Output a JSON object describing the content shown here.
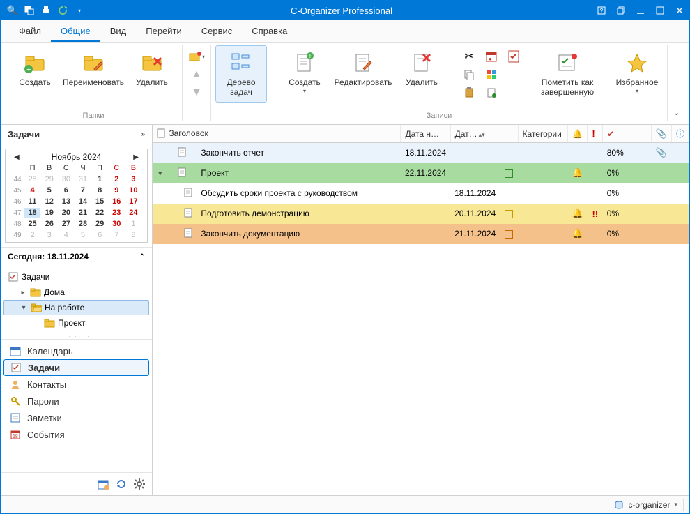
{
  "title": "C-Organizer Professional",
  "menu": [
    "Файл",
    "Общие",
    "Вид",
    "Перейти",
    "Сервис",
    "Справка"
  ],
  "menu_active": 1,
  "ribbon": {
    "groups": [
      {
        "label": "Папки",
        "buttons": [
          "Создать",
          "Переименовать",
          "Удалить"
        ]
      },
      {
        "label": "Записи",
        "tree_btn": "Дерево задач",
        "buttons": [
          "Создать",
          "Редактировать",
          "Удалить"
        ],
        "mark_btn": "Пометить как завершенную",
        "fav_btn": "Избранное"
      }
    ]
  },
  "sidebar": {
    "header": "Задачи",
    "calendar": {
      "month": "Ноябрь 2024",
      "dow": [
        "П",
        "В",
        "С",
        "Ч",
        "П",
        "С",
        "В"
      ],
      "weeks": [
        {
          "wk": "44",
          "days": [
            {
              "d": "28",
              "dim": true
            },
            {
              "d": "29",
              "dim": true
            },
            {
              "d": "30",
              "dim": true
            },
            {
              "d": "31",
              "dim": true
            },
            {
              "d": "1",
              "bold": true
            },
            {
              "d": "2",
              "bold": true,
              "red": true
            },
            {
              "d": "3",
              "bold": true,
              "red": true
            }
          ]
        },
        {
          "wk": "45",
          "days": [
            {
              "d": "4",
              "bold": true,
              "red": true
            },
            {
              "d": "5",
              "bold": true
            },
            {
              "d": "6",
              "bold": true
            },
            {
              "d": "7",
              "bold": true
            },
            {
              "d": "8",
              "bold": true
            },
            {
              "d": "9",
              "bold": true,
              "red": true
            },
            {
              "d": "10",
              "bold": true,
              "red": true
            }
          ]
        },
        {
          "wk": "46",
          "days": [
            {
              "d": "11",
              "bold": true
            },
            {
              "d": "12",
              "bold": true
            },
            {
              "d": "13",
              "bold": true
            },
            {
              "d": "14",
              "bold": true
            },
            {
              "d": "15",
              "bold": true
            },
            {
              "d": "16",
              "bold": true,
              "red": true
            },
            {
              "d": "17",
              "bold": true,
              "red": true
            }
          ]
        },
        {
          "wk": "47",
          "days": [
            {
              "d": "18",
              "bold": true,
              "today": true
            },
            {
              "d": "19",
              "bold": true
            },
            {
              "d": "20",
              "bold": true
            },
            {
              "d": "21",
              "bold": true
            },
            {
              "d": "22",
              "bold": true
            },
            {
              "d": "23",
              "bold": true,
              "red": true
            },
            {
              "d": "24",
              "bold": true,
              "red": true
            }
          ]
        },
        {
          "wk": "48",
          "days": [
            {
              "d": "25",
              "bold": true
            },
            {
              "d": "26",
              "bold": true
            },
            {
              "d": "27",
              "bold": true
            },
            {
              "d": "28",
              "bold": true
            },
            {
              "d": "29",
              "bold": true
            },
            {
              "d": "30",
              "bold": true,
              "red": true
            },
            {
              "d": "1",
              "dim": true,
              "red": true
            }
          ]
        },
        {
          "wk": "49",
          "days": [
            {
              "d": "2",
              "dim": true
            },
            {
              "d": "3",
              "dim": true
            },
            {
              "d": "4",
              "dim": true
            },
            {
              "d": "5",
              "dim": true
            },
            {
              "d": "6",
              "dim": true
            },
            {
              "d": "7",
              "dim": true,
              "red": true
            },
            {
              "d": "8",
              "dim": true,
              "red": true
            }
          ]
        }
      ]
    },
    "today_label": "Сегодня: 18.11.2024",
    "tree": {
      "root": "Задачи",
      "nodes": [
        {
          "label": "Дома",
          "expanded": false,
          "indent": 1
        },
        {
          "label": "На работе",
          "expanded": true,
          "indent": 1,
          "selected": true
        },
        {
          "label": "Проект",
          "indent": 2
        }
      ]
    },
    "nav": [
      "Календарь",
      "Задачи",
      "Контакты",
      "Пароли",
      "Заметки",
      "События"
    ],
    "nav_selected": 1
  },
  "grid": {
    "columns": [
      "Заголовок",
      "Дата н…",
      "Дат…",
      "",
      "Категории",
      "",
      "",
      "",
      "",
      ""
    ],
    "rows": [
      {
        "style": "sel",
        "indent": 0,
        "title": "Закончить отчет",
        "start": "18.11.2024",
        "due": "",
        "chk": null,
        "alarm": false,
        "excl": false,
        "pct": "80%",
        "clip": true
      },
      {
        "style": "green",
        "indent": 0,
        "expand": true,
        "title": "Проект",
        "start": "22.11.2024",
        "due": "",
        "chk": "green",
        "alarm": true,
        "excl": false,
        "pct": "0%",
        "clip": false
      },
      {
        "style": "plain",
        "indent": 1,
        "title": "Обсудить сроки проекта с руководством",
        "start": "",
        "due": "18.11.2024",
        "chk": null,
        "alarm": false,
        "excl": false,
        "pct": "0%",
        "clip": false
      },
      {
        "style": "yellow",
        "indent": 1,
        "title": "Подготовить демонстрацию",
        "start": "",
        "due": "20.11.2024",
        "chk": "gold",
        "alarm": true,
        "excl": true,
        "pct": "0%",
        "clip": false
      },
      {
        "style": "orange",
        "indent": 1,
        "title": "Закончить документацию",
        "start": "",
        "due": "21.11.2024",
        "chk": "orange",
        "alarm": true,
        "excl": false,
        "pct": "0%",
        "clip": false
      }
    ]
  },
  "status": {
    "db": "c-organizer"
  }
}
